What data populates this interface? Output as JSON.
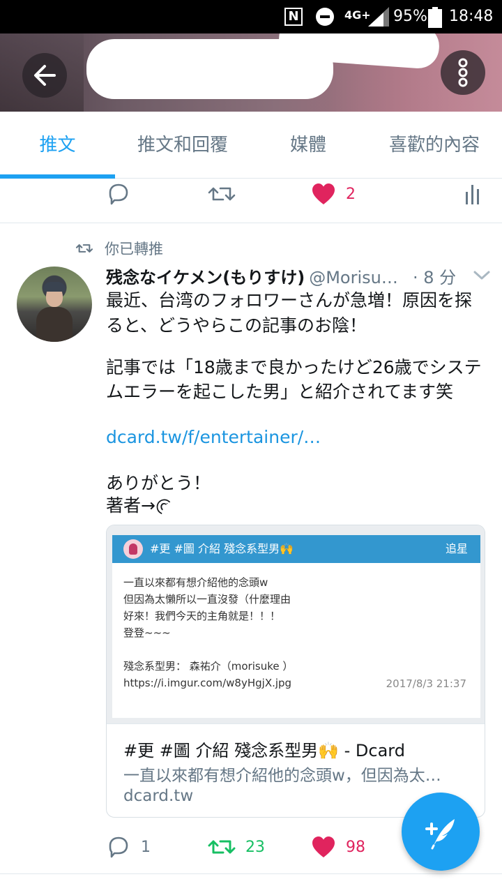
{
  "status_bar": {
    "nfc": "N",
    "network": "4G+",
    "battery": "95%",
    "time": "18:48"
  },
  "header": {
    "back_icon": "arrow-left-icon",
    "more_icon": "more-vertical-icon"
  },
  "tabs": [
    {
      "label": "推文",
      "active": true
    },
    {
      "label": "推文和回覆",
      "active": false
    },
    {
      "label": "媒體",
      "active": false
    },
    {
      "label": "喜歡的內容",
      "active": false
    }
  ],
  "prev_tweet_actions": {
    "likes": "2"
  },
  "tweet": {
    "retweet_note": "你已轉推",
    "author_name": "残念なイケメン(もりすけ)",
    "author_handle": "@Morisu…",
    "time": "· 8 分",
    "lines": {
      "l1": "最近、台湾のフォロワーさんが急増！原因を探",
      "l2": "ると、どうやらこの記事のお陰！",
      "l3": "記事では「18歳まで良かったけど26歳でシステ",
      "l4": "ムエラーを起こした男」と紹介されてます笑",
      "link": "dcard.tw/f/entertainer/…",
      "l5": "ありがとう！",
      "l6": "著者→@"
    },
    "card": {
      "preview": {
        "title": "#更 #圖 介紹 殘念系型男🙌",
        "forum": "追星",
        "body1": "一直以來都有想介紹他的念頭w",
        "body2": "但因為太懶所以一直沒發（什麼理由",
        "body3": "好來！我們今天的主角就是！！！",
        "body4": "登登~~~",
        "body5": "殘念系型男： 森祐介（morisuke ）",
        "body6": "https://i.imgur.com/w8yHgjX.jpg",
        "date": "2017/8/3 21:37"
      },
      "title": "#更 #圖 介紹 殘念系型男🙌 - Dcard",
      "description": "一直以來都有想介紹他的念頭w，但因為太…",
      "domain": "dcard.tw"
    },
    "actions": {
      "replies": "1",
      "retweets": "23",
      "likes": "98"
    }
  },
  "colors": {
    "accent": "#1da1f2",
    "retweet_green": "#17bf63",
    "like_red": "#e0245e"
  }
}
